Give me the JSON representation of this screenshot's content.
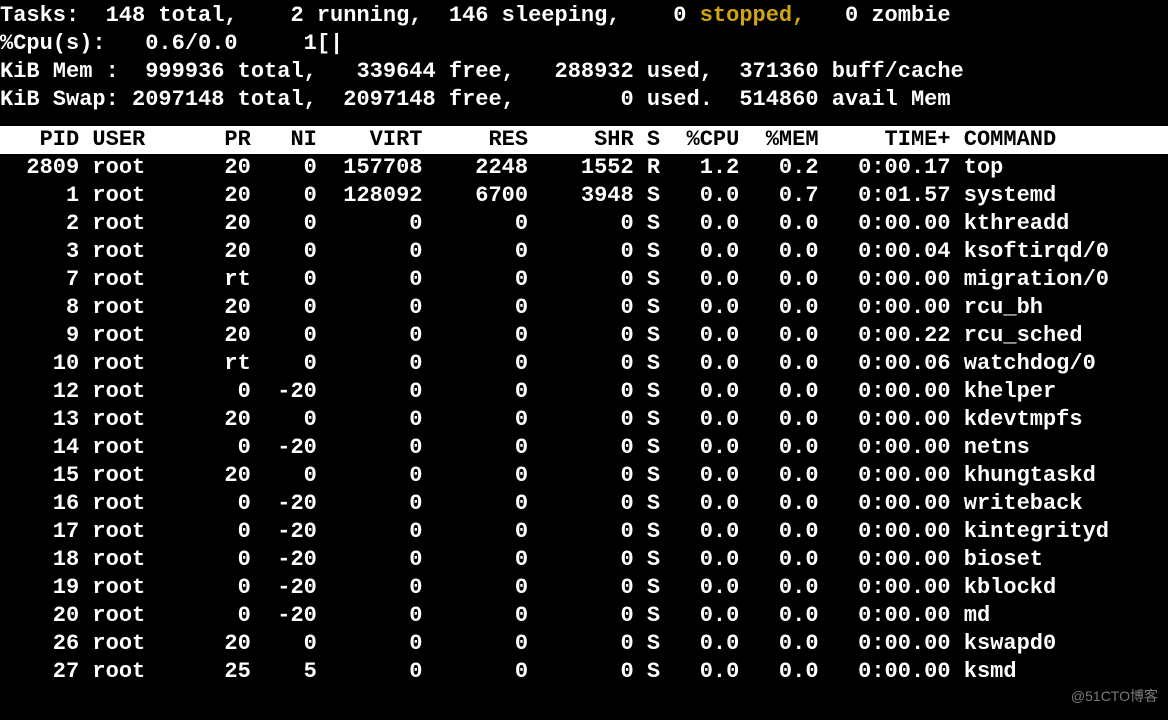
{
  "summary": {
    "tasks": {
      "label": "Tasks:",
      "total": "148 total,",
      "running": "2 running,",
      "sleeping": "146 sleeping,",
      "stopped_n": "0",
      "stopped_label": "stopped,",
      "zombie": "0 zombie"
    },
    "cpu": {
      "label": "%Cpu(s):",
      "vals": "0.6/0.0",
      "bar": "1[|"
    },
    "mem": {
      "label": "KiB Mem :",
      "total": "999936 total,",
      "free": "339644 free,",
      "used": "288932 used,",
      "buff": "371360 buff/cache"
    },
    "swap": {
      "label": "KiB Swap:",
      "total": "2097148 total,",
      "free": "2097148 free,",
      "used": "0 used.",
      "avail": "514860 avail Mem"
    }
  },
  "headers": [
    "PID",
    "USER",
    "PR",
    "NI",
    "VIRT",
    "RES",
    "SHR",
    "S",
    "%CPU",
    "%MEM",
    "TIME+",
    "COMMAND"
  ],
  "processes": [
    {
      "pid": "2809",
      "user": "root",
      "pr": "20",
      "ni": "0",
      "virt": "157708",
      "res": "2248",
      "shr": "1552",
      "s": "R",
      "cpu": "1.2",
      "mem": "0.2",
      "time": "0:00.17",
      "cmd": "top"
    },
    {
      "pid": "1",
      "user": "root",
      "pr": "20",
      "ni": "0",
      "virt": "128092",
      "res": "6700",
      "shr": "3948",
      "s": "S",
      "cpu": "0.0",
      "mem": "0.7",
      "time": "0:01.57",
      "cmd": "systemd"
    },
    {
      "pid": "2",
      "user": "root",
      "pr": "20",
      "ni": "0",
      "virt": "0",
      "res": "0",
      "shr": "0",
      "s": "S",
      "cpu": "0.0",
      "mem": "0.0",
      "time": "0:00.00",
      "cmd": "kthreadd"
    },
    {
      "pid": "3",
      "user": "root",
      "pr": "20",
      "ni": "0",
      "virt": "0",
      "res": "0",
      "shr": "0",
      "s": "S",
      "cpu": "0.0",
      "mem": "0.0",
      "time": "0:00.04",
      "cmd": "ksoftirqd/0"
    },
    {
      "pid": "7",
      "user": "root",
      "pr": "rt",
      "ni": "0",
      "virt": "0",
      "res": "0",
      "shr": "0",
      "s": "S",
      "cpu": "0.0",
      "mem": "0.0",
      "time": "0:00.00",
      "cmd": "migration/0"
    },
    {
      "pid": "8",
      "user": "root",
      "pr": "20",
      "ni": "0",
      "virt": "0",
      "res": "0",
      "shr": "0",
      "s": "S",
      "cpu": "0.0",
      "mem": "0.0",
      "time": "0:00.00",
      "cmd": "rcu_bh"
    },
    {
      "pid": "9",
      "user": "root",
      "pr": "20",
      "ni": "0",
      "virt": "0",
      "res": "0",
      "shr": "0",
      "s": "S",
      "cpu": "0.0",
      "mem": "0.0",
      "time": "0:00.22",
      "cmd": "rcu_sched"
    },
    {
      "pid": "10",
      "user": "root",
      "pr": "rt",
      "ni": "0",
      "virt": "0",
      "res": "0",
      "shr": "0",
      "s": "S",
      "cpu": "0.0",
      "mem": "0.0",
      "time": "0:00.06",
      "cmd": "watchdog/0"
    },
    {
      "pid": "12",
      "user": "root",
      "pr": "0",
      "ni": "-20",
      "virt": "0",
      "res": "0",
      "shr": "0",
      "s": "S",
      "cpu": "0.0",
      "mem": "0.0",
      "time": "0:00.00",
      "cmd": "khelper"
    },
    {
      "pid": "13",
      "user": "root",
      "pr": "20",
      "ni": "0",
      "virt": "0",
      "res": "0",
      "shr": "0",
      "s": "S",
      "cpu": "0.0",
      "mem": "0.0",
      "time": "0:00.00",
      "cmd": "kdevtmpfs"
    },
    {
      "pid": "14",
      "user": "root",
      "pr": "0",
      "ni": "-20",
      "virt": "0",
      "res": "0",
      "shr": "0",
      "s": "S",
      "cpu": "0.0",
      "mem": "0.0",
      "time": "0:00.00",
      "cmd": "netns"
    },
    {
      "pid": "15",
      "user": "root",
      "pr": "20",
      "ni": "0",
      "virt": "0",
      "res": "0",
      "shr": "0",
      "s": "S",
      "cpu": "0.0",
      "mem": "0.0",
      "time": "0:00.00",
      "cmd": "khungtaskd"
    },
    {
      "pid": "16",
      "user": "root",
      "pr": "0",
      "ni": "-20",
      "virt": "0",
      "res": "0",
      "shr": "0",
      "s": "S",
      "cpu": "0.0",
      "mem": "0.0",
      "time": "0:00.00",
      "cmd": "writeback"
    },
    {
      "pid": "17",
      "user": "root",
      "pr": "0",
      "ni": "-20",
      "virt": "0",
      "res": "0",
      "shr": "0",
      "s": "S",
      "cpu": "0.0",
      "mem": "0.0",
      "time": "0:00.00",
      "cmd": "kintegrityd"
    },
    {
      "pid": "18",
      "user": "root",
      "pr": "0",
      "ni": "-20",
      "virt": "0",
      "res": "0",
      "shr": "0",
      "s": "S",
      "cpu": "0.0",
      "mem": "0.0",
      "time": "0:00.00",
      "cmd": "bioset"
    },
    {
      "pid": "19",
      "user": "root",
      "pr": "0",
      "ni": "-20",
      "virt": "0",
      "res": "0",
      "shr": "0",
      "s": "S",
      "cpu": "0.0",
      "mem": "0.0",
      "time": "0:00.00",
      "cmd": "kblockd"
    },
    {
      "pid": "20",
      "user": "root",
      "pr": "0",
      "ni": "-20",
      "virt": "0",
      "res": "0",
      "shr": "0",
      "s": "S",
      "cpu": "0.0",
      "mem": "0.0",
      "time": "0:00.00",
      "cmd": "md"
    },
    {
      "pid": "26",
      "user": "root",
      "pr": "20",
      "ni": "0",
      "virt": "0",
      "res": "0",
      "shr": "0",
      "s": "S",
      "cpu": "0.0",
      "mem": "0.0",
      "time": "0:00.00",
      "cmd": "kswapd0"
    },
    {
      "pid": "27",
      "user": "root",
      "pr": "25",
      "ni": "5",
      "virt": "0",
      "res": "0",
      "shr": "0",
      "s": "S",
      "cpu": "0.0",
      "mem": "0.0",
      "time": "0:00.00",
      "cmd": "ksmd"
    }
  ],
  "watermark": "@51CTO博客"
}
